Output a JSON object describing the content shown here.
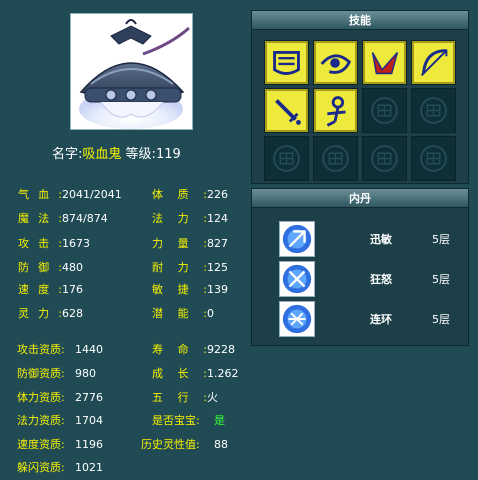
{
  "pet": {
    "name_label": "名字:",
    "name": "吸血鬼",
    "level_label": "等级:",
    "level": "119"
  },
  "stats": [
    {
      "label": "气血:",
      "value": "2041/2041"
    },
    {
      "label": "魔法:",
      "value": "874/874"
    },
    {
      "label": "攻击:",
      "value": "1673"
    },
    {
      "label": "防御:",
      "value": "480"
    },
    {
      "label": "速度:",
      "value": "176"
    },
    {
      "label": "灵力:",
      "value": "628"
    }
  ],
  "attributes": [
    {
      "label": "体质:",
      "value": "226"
    },
    {
      "label": "法力:",
      "value": "124"
    },
    {
      "label": "力量:",
      "value": "827"
    },
    {
      "label": "耐力:",
      "value": "125"
    },
    {
      "label": "敏捷:",
      "value": "139"
    },
    {
      "label": "潜能:",
      "value": "0"
    }
  ],
  "aptitudes": [
    {
      "label": "攻击资质:",
      "value": "1440"
    },
    {
      "label": "防御资质:",
      "value": "980"
    },
    {
      "label": "体力资质:",
      "value": "2776"
    },
    {
      "label": "法力资质:",
      "value": "1704"
    },
    {
      "label": "速度资质:",
      "value": "1196"
    },
    {
      "label": "躲闪资质:",
      "value": "1021"
    }
  ],
  "growth": [
    {
      "label": "寿命:",
      "value": "9228"
    },
    {
      "label": "成长:",
      "value": "1.262"
    },
    {
      "label": "五行:",
      "value": "火"
    },
    {
      "label": "是否宝宝:",
      "value": "是"
    },
    {
      "label": "历史灵性值:",
      "value": "88"
    }
  ],
  "skills_panel": {
    "title": "技能",
    "skills": [
      {
        "icon": "shield-rune-icon"
      },
      {
        "icon": "eye-rune-icon"
      },
      {
        "icon": "counter-strike-icon"
      },
      {
        "icon": "bow-icon"
      },
      {
        "icon": "sword-icon"
      },
      {
        "icon": "person-rune-icon"
      }
    ],
    "empty_slots": 6
  },
  "neidan_panel": {
    "title": "内丹",
    "items": [
      {
        "name": "迅敏",
        "level": "5层",
        "icon": "swift-trident-icon"
      },
      {
        "name": "狂怒",
        "level": "5层",
        "icon": "fury-trident-icon"
      },
      {
        "name": "连环",
        "level": "5层",
        "icon": "chain-trident-icon"
      }
    ]
  },
  "colors": {
    "background": "#204b55",
    "label": "#f6f000",
    "value": "#ffffff",
    "highlight": "#33ff33",
    "skill_slot": "#eeea3c"
  }
}
